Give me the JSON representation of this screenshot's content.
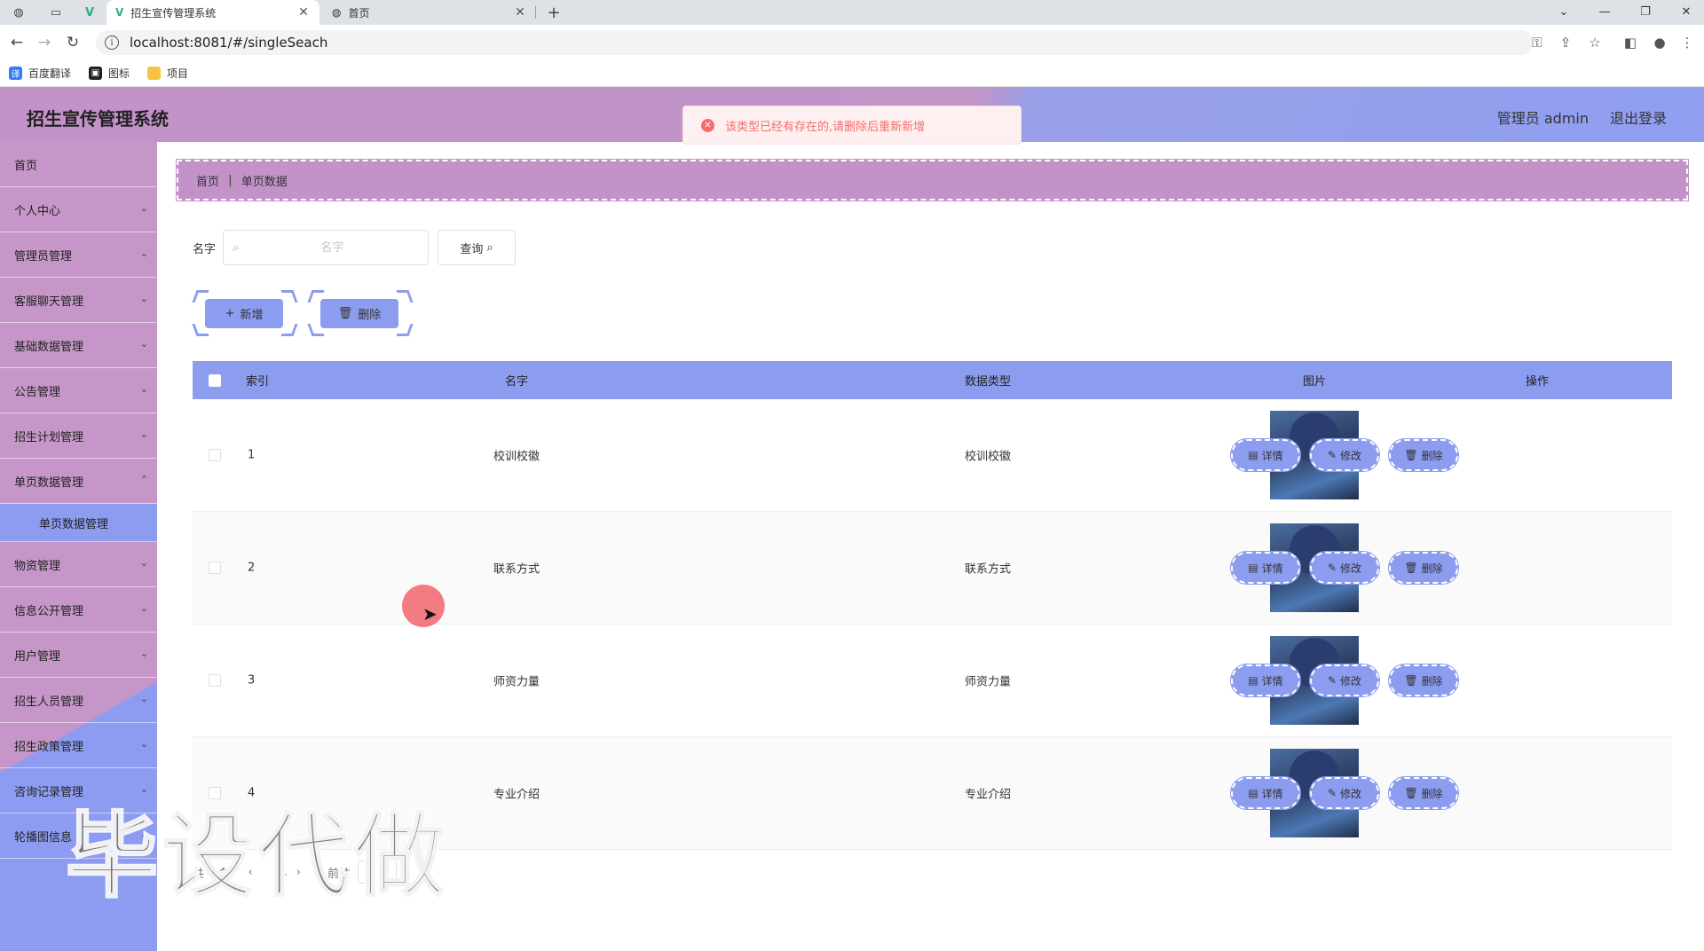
{
  "browser": {
    "tabs": [
      {
        "title": "招生宣传管理系统",
        "active": true
      },
      {
        "title": "首页",
        "active": false
      }
    ],
    "url": "localhost:8081/#/singleSeach",
    "bookmarks": [
      "百度翻译",
      "图标",
      "项目"
    ]
  },
  "header": {
    "title": "招生宣传管理系统",
    "user": "管理员 admin",
    "logout": "退出登录"
  },
  "toast": {
    "message": "该类型已经有存在的,请删除后重新新增"
  },
  "sidebar": {
    "items": [
      {
        "label": "首页",
        "has_children": false
      },
      {
        "label": "个人中心",
        "has_children": true
      },
      {
        "label": "管理员管理",
        "has_children": true
      },
      {
        "label": "客服聊天管理",
        "has_children": true
      },
      {
        "label": "基础数据管理",
        "has_children": true
      },
      {
        "label": "公告管理",
        "has_children": true
      },
      {
        "label": "招生计划管理",
        "has_children": true
      },
      {
        "label": "单页数据管理",
        "has_children": true
      },
      {
        "label": "物资管理",
        "has_children": true
      },
      {
        "label": "信息公开管理",
        "has_children": true
      },
      {
        "label": "用户管理",
        "has_children": true
      },
      {
        "label": "招生人员管理",
        "has_children": true
      },
      {
        "label": "招生政策管理",
        "has_children": true
      },
      {
        "label": "咨询记录管理",
        "has_children": true
      },
      {
        "label": "轮播图信息",
        "has_children": true
      }
    ],
    "submenu_active": "单页数据管理"
  },
  "breadcrumb": [
    "首页",
    "单页数据"
  ],
  "search": {
    "label": "名字",
    "placeholder": "名字",
    "value": "",
    "button": "查询"
  },
  "actions": {
    "add": "新增",
    "delete": "删除"
  },
  "table": {
    "columns": [
      "索引",
      "名字",
      "数据类型",
      "图片",
      "操作"
    ],
    "rows": [
      {
        "index": "1",
        "name": "校训校徽",
        "type": "校训校徽"
      },
      {
        "index": "2",
        "name": "联系方式",
        "type": "联系方式"
      },
      {
        "index": "3",
        "name": "师资力量",
        "type": "师资力量"
      },
      {
        "index": "4",
        "name": "专业介绍",
        "type": "专业介绍"
      }
    ],
    "row_buttons": [
      "详情",
      "修改",
      "删除"
    ]
  },
  "pager": {
    "total": "共 4 条",
    "current_page": "1",
    "goto": "前往"
  },
  "watermark": "毕设代做",
  "colors": {
    "header_pink": "#c292c8",
    "accent_blue": "#8c9cef",
    "toast_text": "#f56c6c",
    "pager_active": "#2ab07d"
  }
}
